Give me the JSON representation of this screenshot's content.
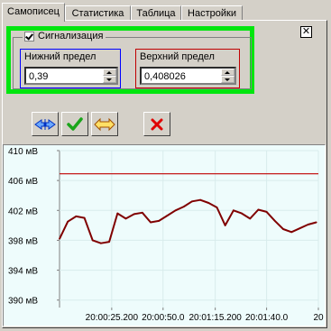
{
  "tabs": [
    {
      "label": "Самописец",
      "active": true
    },
    {
      "label": "Статистика",
      "active": false
    },
    {
      "label": "Таблица",
      "active": false
    },
    {
      "label": "Настройки",
      "active": false
    }
  ],
  "alarm": {
    "label": "Сигнализация",
    "checked": true,
    "lower": {
      "label": "Нижний предел",
      "value": "0,39"
    },
    "upper": {
      "label": "Верхний предел",
      "value": "0,408026"
    }
  },
  "close_glyph": "✕",
  "toolbar": [
    {
      "name": "compress-icon"
    },
    {
      "name": "checkmark-icon"
    },
    {
      "name": "expand-icon"
    },
    {
      "name": "delete-icon"
    }
  ],
  "colors": {
    "highlight": "#00e60f",
    "lower_box": "#0000ff",
    "upper_box": "#c00000",
    "series": "#800000",
    "limit_line": "#c00000",
    "plot_bg": "#eefcfc"
  },
  "chart_data": {
    "type": "line",
    "y_unit": "мВ",
    "ylim": [
      389,
      410
    ],
    "y_ticks": [
      "410 мВ",
      "406 мВ",
      "402 мВ",
      "398 мВ",
      "394 мВ",
      "390 мВ"
    ],
    "y_tick_values": [
      410,
      406,
      402,
      398,
      394,
      390
    ],
    "x_ticks": [
      "20:00:25.200",
      "20:00:50.0",
      "20:01:15.200",
      "20:01:40.0",
      "20"
    ],
    "x_tick_values": [
      25.2,
      50.0,
      75.2,
      100.0,
      125.0
    ],
    "xlim": [
      0,
      125
    ],
    "grid": true,
    "limit_line": {
      "value": 406.9,
      "label": "Верхний предел"
    },
    "series": [
      {
        "x": [
          0,
          4,
          8,
          12,
          16,
          20,
          24,
          28,
          32,
          36,
          40,
          44,
          48,
          52,
          56,
          60,
          64,
          68,
          72,
          76,
          80,
          84,
          88,
          92,
          96,
          100,
          104,
          108,
          112,
          116,
          120,
          124
        ],
        "y": [
          398.2,
          400.5,
          401.2,
          401.0,
          398.0,
          397.6,
          397.8,
          401.6,
          400.9,
          401.5,
          401.7,
          400.4,
          400.6,
          401.3,
          402.0,
          402.5,
          403.2,
          403.4,
          403.0,
          402.4,
          400.0,
          402.0,
          401.6,
          400.9,
          402.1,
          401.8,
          400.6,
          399.5,
          399.1,
          399.6,
          400.1,
          400.4
        ]
      }
    ]
  }
}
